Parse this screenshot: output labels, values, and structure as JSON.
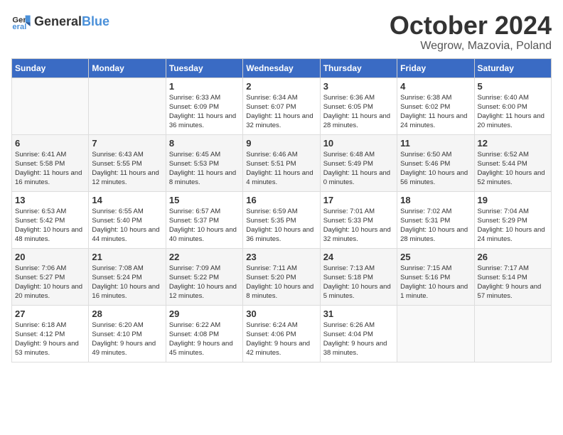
{
  "header": {
    "logo": {
      "text_general": "General",
      "text_blue": "Blue"
    },
    "month_title": "October 2024",
    "location": "Wegrow, Mazovia, Poland"
  },
  "weekdays": [
    "Sunday",
    "Monday",
    "Tuesday",
    "Wednesday",
    "Thursday",
    "Friday",
    "Saturday"
  ],
  "weeks": [
    [
      {
        "day": "",
        "sunrise": "",
        "sunset": "",
        "daylight": ""
      },
      {
        "day": "",
        "sunrise": "",
        "sunset": "",
        "daylight": ""
      },
      {
        "day": "1",
        "sunrise": "Sunrise: 6:33 AM",
        "sunset": "Sunset: 6:09 PM",
        "daylight": "Daylight: 11 hours and 36 minutes."
      },
      {
        "day": "2",
        "sunrise": "Sunrise: 6:34 AM",
        "sunset": "Sunset: 6:07 PM",
        "daylight": "Daylight: 11 hours and 32 minutes."
      },
      {
        "day": "3",
        "sunrise": "Sunrise: 6:36 AM",
        "sunset": "Sunset: 6:05 PM",
        "daylight": "Daylight: 11 hours and 28 minutes."
      },
      {
        "day": "4",
        "sunrise": "Sunrise: 6:38 AM",
        "sunset": "Sunset: 6:02 PM",
        "daylight": "Daylight: 11 hours and 24 minutes."
      },
      {
        "day": "5",
        "sunrise": "Sunrise: 6:40 AM",
        "sunset": "Sunset: 6:00 PM",
        "daylight": "Daylight: 11 hours and 20 minutes."
      }
    ],
    [
      {
        "day": "6",
        "sunrise": "Sunrise: 6:41 AM",
        "sunset": "Sunset: 5:58 PM",
        "daylight": "Daylight: 11 hours and 16 minutes."
      },
      {
        "day": "7",
        "sunrise": "Sunrise: 6:43 AM",
        "sunset": "Sunset: 5:55 PM",
        "daylight": "Daylight: 11 hours and 12 minutes."
      },
      {
        "day": "8",
        "sunrise": "Sunrise: 6:45 AM",
        "sunset": "Sunset: 5:53 PM",
        "daylight": "Daylight: 11 hours and 8 minutes."
      },
      {
        "day": "9",
        "sunrise": "Sunrise: 6:46 AM",
        "sunset": "Sunset: 5:51 PM",
        "daylight": "Daylight: 11 hours and 4 minutes."
      },
      {
        "day": "10",
        "sunrise": "Sunrise: 6:48 AM",
        "sunset": "Sunset: 5:49 PM",
        "daylight": "Daylight: 11 hours and 0 minutes."
      },
      {
        "day": "11",
        "sunrise": "Sunrise: 6:50 AM",
        "sunset": "Sunset: 5:46 PM",
        "daylight": "Daylight: 10 hours and 56 minutes."
      },
      {
        "day": "12",
        "sunrise": "Sunrise: 6:52 AM",
        "sunset": "Sunset: 5:44 PM",
        "daylight": "Daylight: 10 hours and 52 minutes."
      }
    ],
    [
      {
        "day": "13",
        "sunrise": "Sunrise: 6:53 AM",
        "sunset": "Sunset: 5:42 PM",
        "daylight": "Daylight: 10 hours and 48 minutes."
      },
      {
        "day": "14",
        "sunrise": "Sunrise: 6:55 AM",
        "sunset": "Sunset: 5:40 PM",
        "daylight": "Daylight: 10 hours and 44 minutes."
      },
      {
        "day": "15",
        "sunrise": "Sunrise: 6:57 AM",
        "sunset": "Sunset: 5:37 PM",
        "daylight": "Daylight: 10 hours and 40 minutes."
      },
      {
        "day": "16",
        "sunrise": "Sunrise: 6:59 AM",
        "sunset": "Sunset: 5:35 PM",
        "daylight": "Daylight: 10 hours and 36 minutes."
      },
      {
        "day": "17",
        "sunrise": "Sunrise: 7:01 AM",
        "sunset": "Sunset: 5:33 PM",
        "daylight": "Daylight: 10 hours and 32 minutes."
      },
      {
        "day": "18",
        "sunrise": "Sunrise: 7:02 AM",
        "sunset": "Sunset: 5:31 PM",
        "daylight": "Daylight: 10 hours and 28 minutes."
      },
      {
        "day": "19",
        "sunrise": "Sunrise: 7:04 AM",
        "sunset": "Sunset: 5:29 PM",
        "daylight": "Daylight: 10 hours and 24 minutes."
      }
    ],
    [
      {
        "day": "20",
        "sunrise": "Sunrise: 7:06 AM",
        "sunset": "Sunset: 5:27 PM",
        "daylight": "Daylight: 10 hours and 20 minutes."
      },
      {
        "day": "21",
        "sunrise": "Sunrise: 7:08 AM",
        "sunset": "Sunset: 5:24 PM",
        "daylight": "Daylight: 10 hours and 16 minutes."
      },
      {
        "day": "22",
        "sunrise": "Sunrise: 7:09 AM",
        "sunset": "Sunset: 5:22 PM",
        "daylight": "Daylight: 10 hours and 12 minutes."
      },
      {
        "day": "23",
        "sunrise": "Sunrise: 7:11 AM",
        "sunset": "Sunset: 5:20 PM",
        "daylight": "Daylight: 10 hours and 8 minutes."
      },
      {
        "day": "24",
        "sunrise": "Sunrise: 7:13 AM",
        "sunset": "Sunset: 5:18 PM",
        "daylight": "Daylight: 10 hours and 5 minutes."
      },
      {
        "day": "25",
        "sunrise": "Sunrise: 7:15 AM",
        "sunset": "Sunset: 5:16 PM",
        "daylight": "Daylight: 10 hours and 1 minute."
      },
      {
        "day": "26",
        "sunrise": "Sunrise: 7:17 AM",
        "sunset": "Sunset: 5:14 PM",
        "daylight": "Daylight: 9 hours and 57 minutes."
      }
    ],
    [
      {
        "day": "27",
        "sunrise": "Sunrise: 6:18 AM",
        "sunset": "Sunset: 4:12 PM",
        "daylight": "Daylight: 9 hours and 53 minutes."
      },
      {
        "day": "28",
        "sunrise": "Sunrise: 6:20 AM",
        "sunset": "Sunset: 4:10 PM",
        "daylight": "Daylight: 9 hours and 49 minutes."
      },
      {
        "day": "29",
        "sunrise": "Sunrise: 6:22 AM",
        "sunset": "Sunset: 4:08 PM",
        "daylight": "Daylight: 9 hours and 45 minutes."
      },
      {
        "day": "30",
        "sunrise": "Sunrise: 6:24 AM",
        "sunset": "Sunset: 4:06 PM",
        "daylight": "Daylight: 9 hours and 42 minutes."
      },
      {
        "day": "31",
        "sunrise": "Sunrise: 6:26 AM",
        "sunset": "Sunset: 4:04 PM",
        "daylight": "Daylight: 9 hours and 38 minutes."
      },
      {
        "day": "",
        "sunrise": "",
        "sunset": "",
        "daylight": ""
      },
      {
        "day": "",
        "sunrise": "",
        "sunset": "",
        "daylight": ""
      }
    ]
  ]
}
